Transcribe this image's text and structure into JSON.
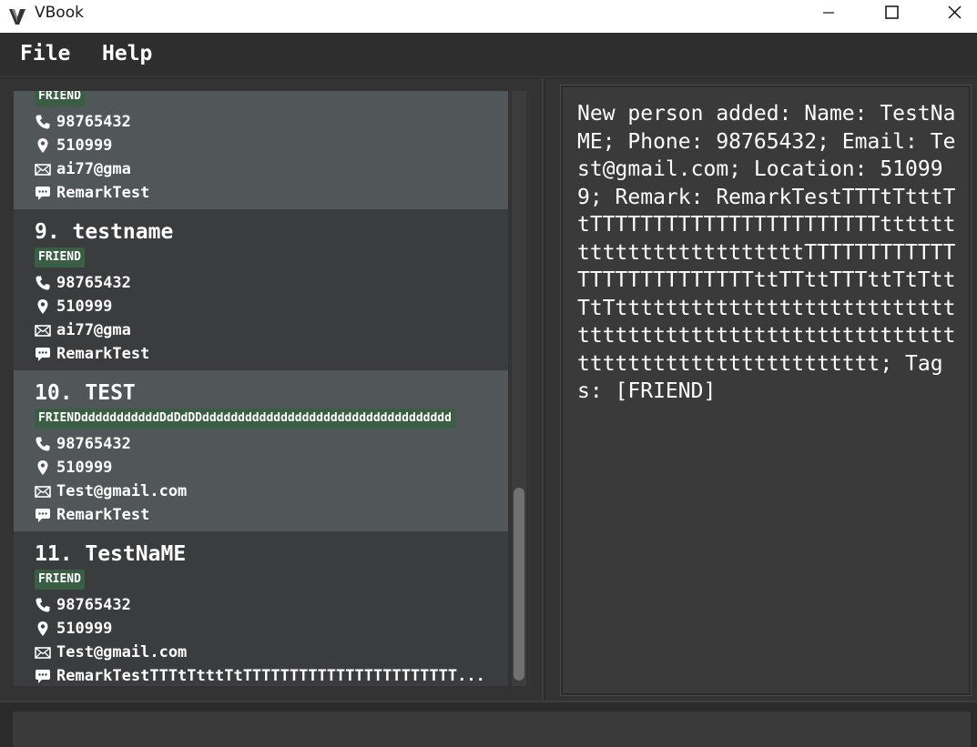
{
  "window": {
    "title": "VBook",
    "icon": "vbook-logo-icon",
    "controls": [
      "minimize-icon",
      "maximize-icon",
      "close-icon"
    ]
  },
  "menu": {
    "file": "File",
    "help": "Help"
  },
  "persons": [
    {
      "name": "",
      "tag": "FRIEND",
      "phone": "98765432",
      "address": "510999",
      "email": "ai77@gma",
      "remark": "RemarkTest"
    },
    {
      "name": "9. testname",
      "tag": "FRIEND",
      "phone": "98765432",
      "address": "510999",
      "email": "ai77@gma",
      "remark": "RemarkTest"
    },
    {
      "name": "10. TEST",
      "tag": "FRIENDdddddddddddDdDdDDddddddddddddddddddddddddddddddddddd",
      "phone": "98765432",
      "address": "510999",
      "email": "Test@gmail.com",
      "remark": "RemarkTest"
    },
    {
      "name": "11. TestNaME",
      "tag": "FRIEND",
      "phone": "98765432",
      "address": "510999",
      "email": "Test@gmail.com",
      "remark": "RemarkTestTTTtTtttTtTTTTTTTTTTTTTTTTTTTTTTT..."
    }
  ],
  "icons": {
    "phone": "phone-icon",
    "address": "location-pin-icon",
    "email": "envelope-icon",
    "remark": "speech-bubble-icon"
  },
  "result": {
    "text": "New person added: Name: TestNaME; Phone: 98765432; Email: Test@gmail.com; Location: 510999; Remark: RemarkTestTTTtTtttTtTTTTTTTTTTTTTTTTTTTTTTTttttttttttttttttttttttttTTTTTTTTTTTTTTTTTTTTTTTTTTttTTttTTTttTtTttTtTttttttttttttttttttttttttttttttttttttttttttttttttttttttttttttttttttttttttttttttttt; Tags: [FRIEND]"
  },
  "status": {
    "text": ""
  },
  "colors": {
    "background": "#2b2b2b",
    "card_selected": "#515658",
    "card_default": "#3b3c3e",
    "tag_bg": "#3a5e44",
    "text": "#ffffff"
  }
}
